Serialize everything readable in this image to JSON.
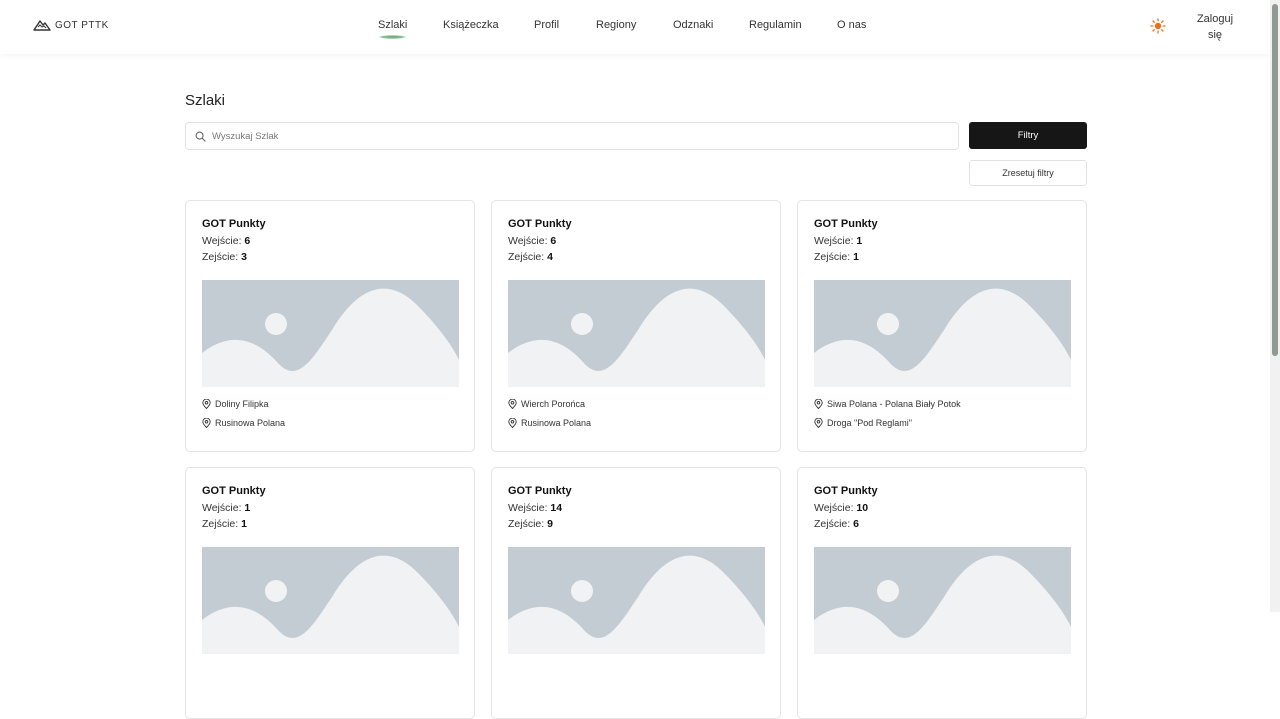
{
  "header": {
    "logo_text": "GOT PTTK",
    "nav": [
      "Szlaki",
      "Książeczka",
      "Profil",
      "Regiony",
      "Odznaki",
      "Regulamin",
      "O nas"
    ],
    "active_nav": "Szlaki",
    "login_line1": "Zaloguj",
    "login_line2": "się"
  },
  "page": {
    "title": "Szlaki",
    "search_placeholder": "Wyszukaj Szlak",
    "filters_button": "Filtry",
    "reset_button": "Zresetuj filtry"
  },
  "cards": [
    {
      "title": "GOT Punkty",
      "in_label": "Wejście:",
      "in_value": "6",
      "out_label": "Zejście:",
      "out_value": "3",
      "from": "Doliny Filipka",
      "to": "Rusinowa Polana"
    },
    {
      "title": "GOT Punkty",
      "in_label": "Wejście:",
      "in_value": "6",
      "out_label": "Zejście:",
      "out_value": "4",
      "from": "Wierch Porońca",
      "to": "Rusinowa Polana"
    },
    {
      "title": "GOT Punkty",
      "in_label": "Wejście:",
      "in_value": "1",
      "out_label": "Zejście:",
      "out_value": "1",
      "from": "Siwa Polana - Polana Biały Potok",
      "to": "Droga \"Pod Reglami\""
    },
    {
      "title": "GOT Punkty",
      "in_label": "Wejście:",
      "in_value": "1",
      "out_label": "Zejście:",
      "out_value": "1",
      "from": "",
      "to": ""
    },
    {
      "title": "GOT Punkty",
      "in_label": "Wejście:",
      "in_value": "14",
      "out_label": "Zejście:",
      "out_value": "9",
      "from": "",
      "to": ""
    },
    {
      "title": "GOT Punkty",
      "in_label": "Wejście:",
      "in_value": "10",
      "out_label": "Zejście:",
      "out_value": "6",
      "from": "",
      "to": ""
    }
  ],
  "icons": {
    "logo": "mountain-icon",
    "theme": "sun-icon",
    "search": "search-icon",
    "location": "map-pin-icon",
    "placeholder": "image-placeholder-icon"
  },
  "colors": {
    "accent": "#6aa874",
    "sun": "#e8731c",
    "primary_button": "#161616",
    "placeholder_bg": "#c4ccd3",
    "placeholder_fg": "#f1f2f4"
  }
}
